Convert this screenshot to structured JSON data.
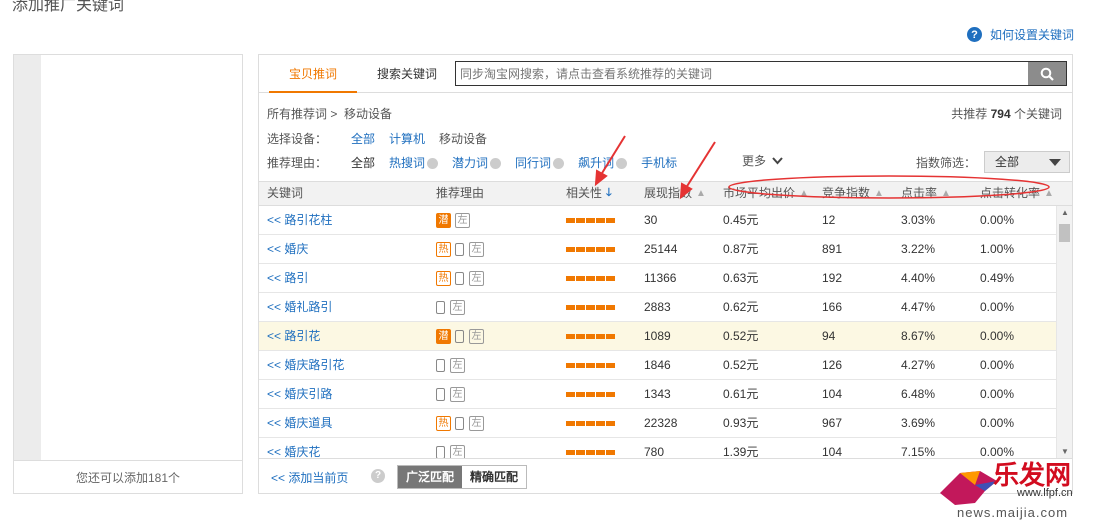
{
  "page_title": "添加推广关键词",
  "help": {
    "label": "如何设置关键词"
  },
  "left_panel": {
    "footer": "您还可以添加181个"
  },
  "tabs": [
    {
      "label": "宝贝推词"
    },
    {
      "label": "搜索关键词"
    }
  ],
  "search": {
    "placeholder": "同步淘宝网搜索，请点击查看系统推荐的关键词"
  },
  "breadcrumb": {
    "root": "所有推荐词 >",
    "current": "移动设备"
  },
  "total": {
    "prefix": "共推荐",
    "count": "794",
    "suffix": "个关键词"
  },
  "device_filter": {
    "label": "选择设备：",
    "options": [
      "全部",
      "计算机",
      "移动设备"
    ]
  },
  "reason_filter": {
    "label": "推荐理由：",
    "options": [
      "全部",
      "热搜词",
      "潜力词",
      "同行词",
      "飙升词",
      "手机标"
    ]
  },
  "more": "更多",
  "index_filter": {
    "label": "指数筛选：",
    "value": "全部"
  },
  "columns": [
    "关键词",
    "推荐理由",
    "相关性",
    "展现指数",
    "市场平均出价",
    "竞争指数",
    "点击率",
    "点击转化率"
  ],
  "rows": [
    {
      "kw": "<< 路引花柱",
      "tags": [
        "潜",
        "左"
      ],
      "rel": 5,
      "show": "30",
      "price": "0.45元",
      "comp": "12",
      "ctr": "3.03%",
      "cvr": "0.00%"
    },
    {
      "kw": "<< 婚庆",
      "tags": [
        "热",
        "mobile",
        "左"
      ],
      "rel": 5,
      "show": "25144",
      "price": "0.87元",
      "comp": "891",
      "ctr": "3.22%",
      "cvr": "1.00%"
    },
    {
      "kw": "<< 路引",
      "tags": [
        "热",
        "mobile",
        "左"
      ],
      "rel": 5,
      "show": "11366",
      "price": "0.63元",
      "comp": "192",
      "ctr": "4.40%",
      "cvr": "0.49%"
    },
    {
      "kw": "<< 婚礼路引",
      "tags": [
        "mobile",
        "左"
      ],
      "rel": 5,
      "show": "2883",
      "price": "0.62元",
      "comp": "166",
      "ctr": "4.47%",
      "cvr": "0.00%"
    },
    {
      "kw": "<< 路引花",
      "tags": [
        "潜",
        "mobile",
        "左"
      ],
      "rel": 5,
      "show": "1089",
      "price": "0.52元",
      "comp": "94",
      "ctr": "8.67%",
      "cvr": "0.00%"
    },
    {
      "kw": "<< 婚庆路引花",
      "tags": [
        "mobile",
        "左"
      ],
      "rel": 5,
      "show": "1846",
      "price": "0.52元",
      "comp": "126",
      "ctr": "4.27%",
      "cvr": "0.00%"
    },
    {
      "kw": "<< 婚庆引路",
      "tags": [
        "mobile",
        "左"
      ],
      "rel": 5,
      "show": "1343",
      "price": "0.61元",
      "comp": "104",
      "ctr": "6.48%",
      "cvr": "0.00%"
    },
    {
      "kw": "<< 婚庆道具",
      "tags": [
        "热",
        "mobile",
        "左"
      ],
      "rel": 5,
      "show": "22328",
      "price": "0.93元",
      "comp": "967",
      "ctr": "3.69%",
      "cvr": "0.00%"
    },
    {
      "kw": "<< 婚庆花",
      "tags": [
        "mobile",
        "左"
      ],
      "rel": 5,
      "show": "780",
      "price": "1.39元",
      "comp": "104",
      "ctr": "7.15%",
      "cvr": "0.00%"
    }
  ],
  "footer": {
    "add_page": "<<  添加当前页",
    "broad": "广泛匹配",
    "exact": "精确匹配"
  },
  "watermark": {
    "brand": "乐发网",
    "site": "www.lfpf.cn",
    "url": "news.maijia.com"
  },
  "colors": {
    "accent": "#f07800",
    "link": "#1f6fbf",
    "annotation": "#e53333"
  }
}
